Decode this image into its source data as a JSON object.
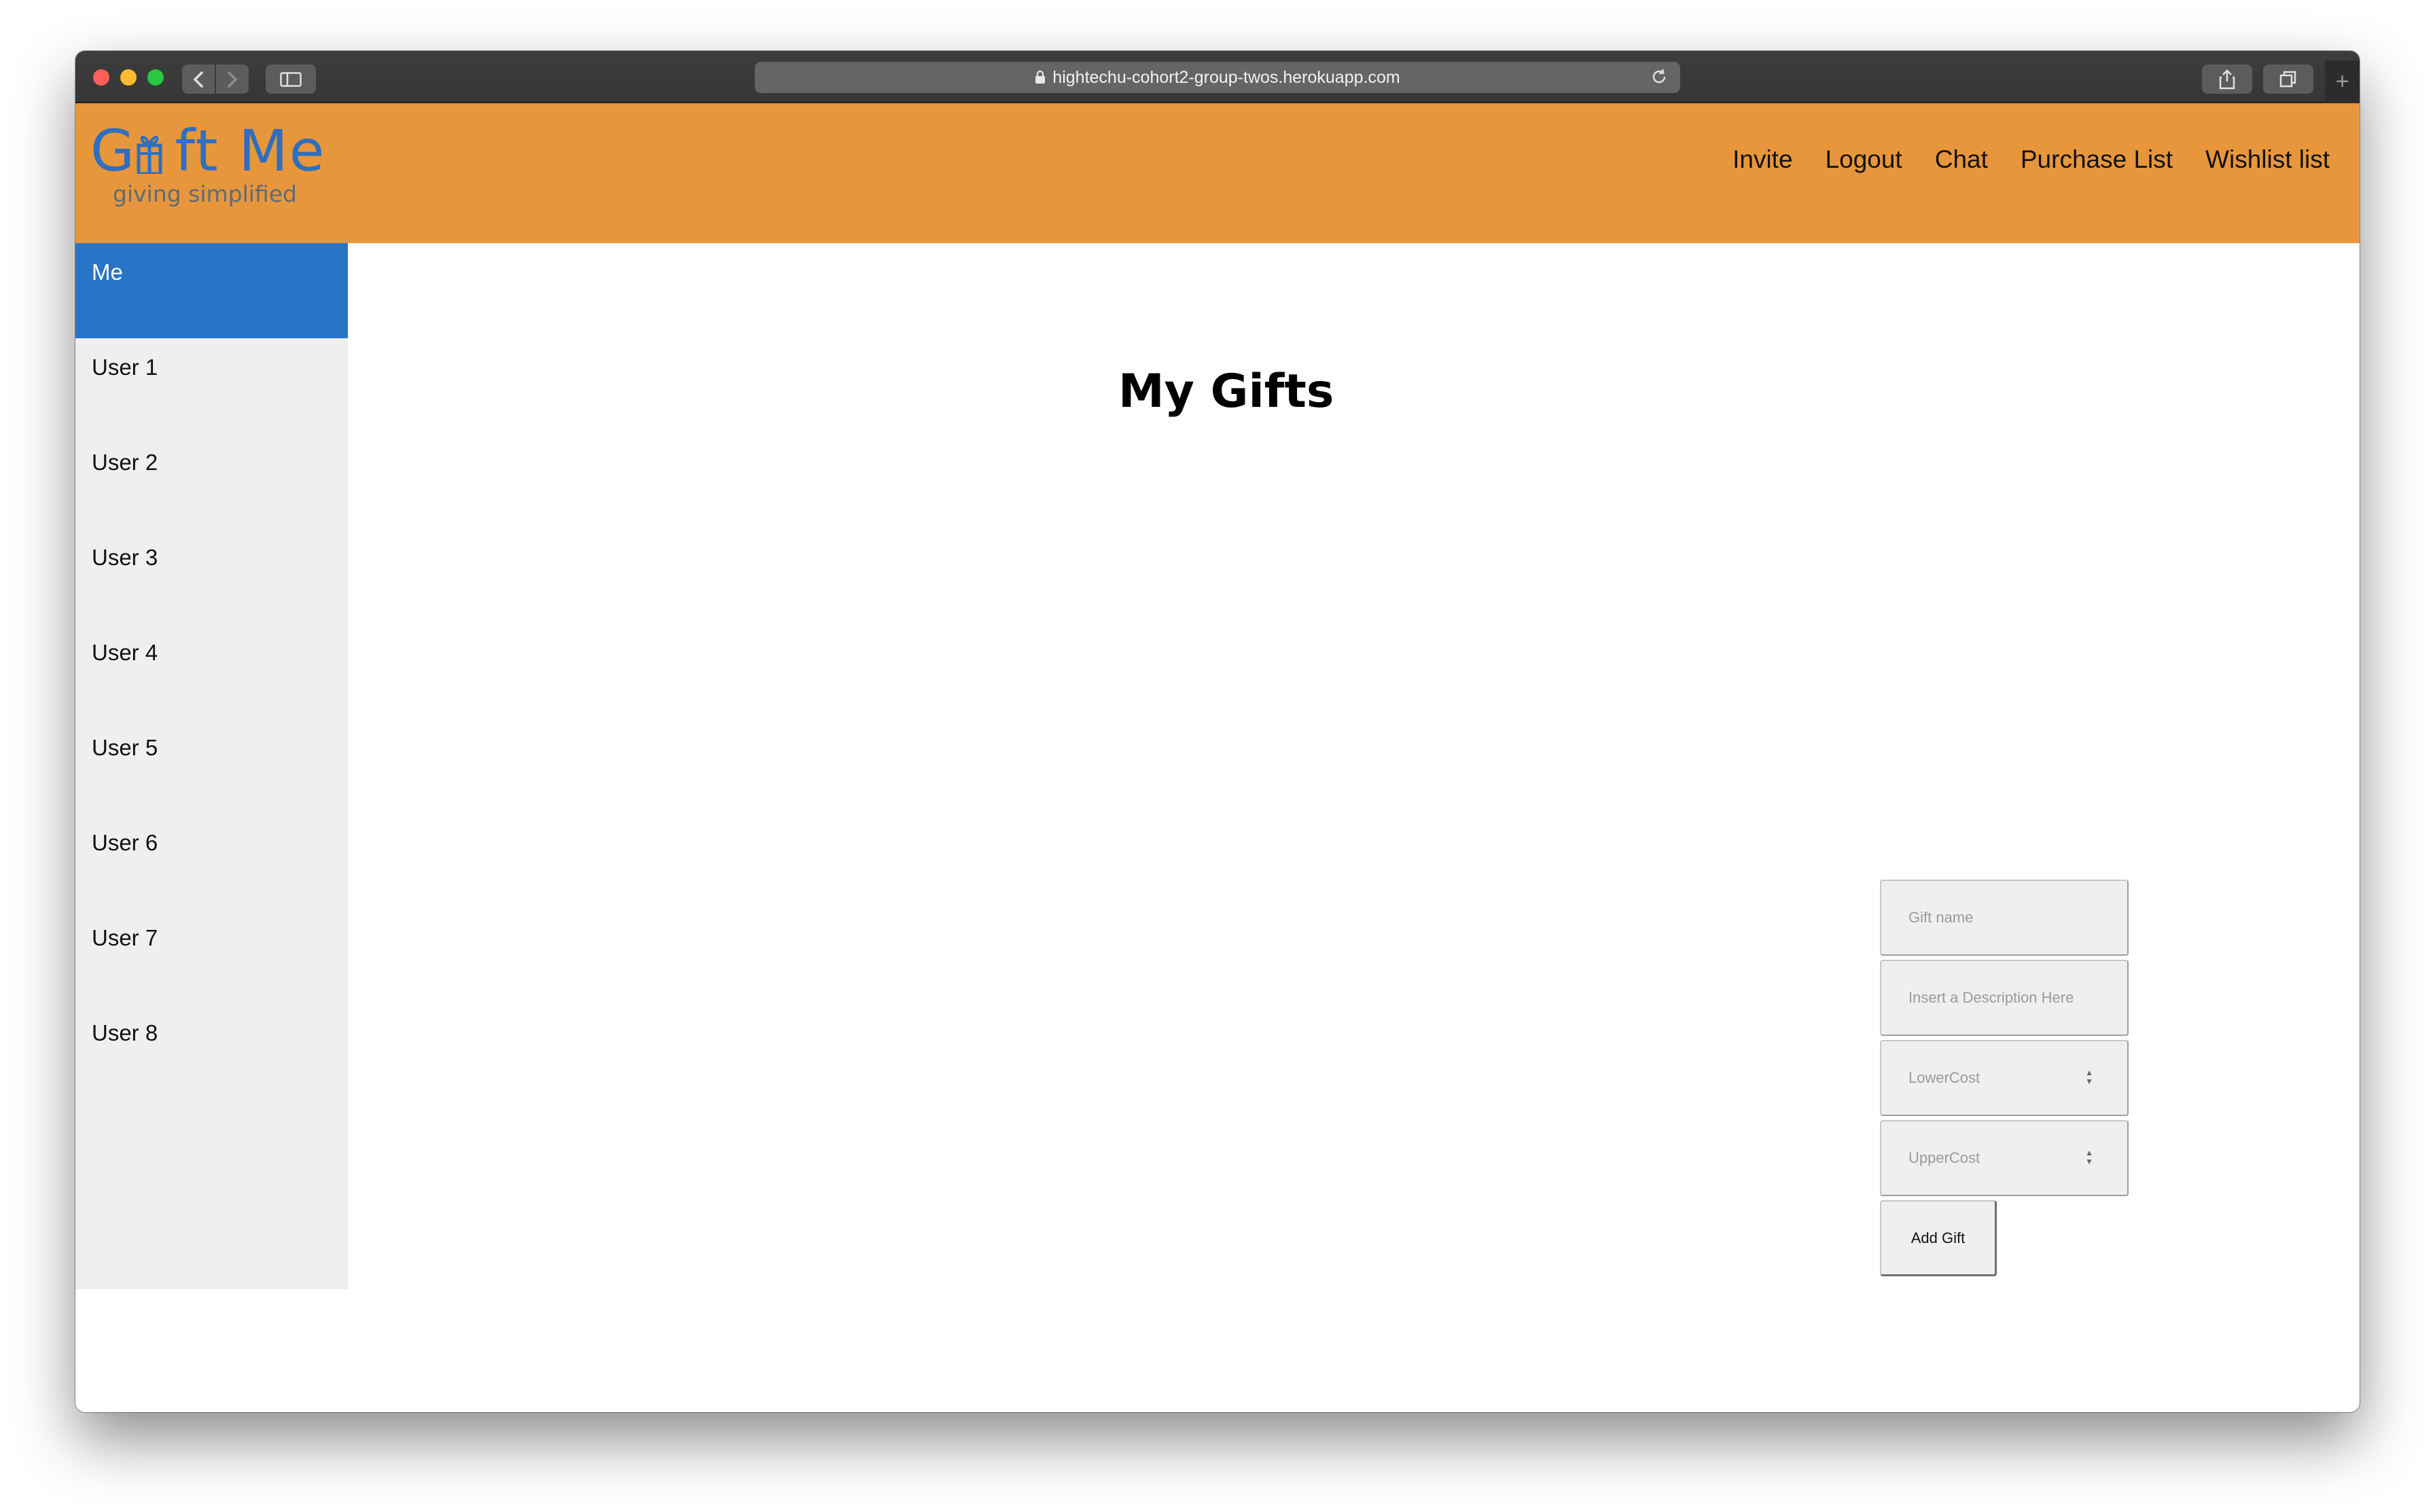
{
  "browser": {
    "url": "hightechu-cohort2-group-twos.herokuapp.com"
  },
  "header": {
    "logo_title": "G  ft Me",
    "logo_tagline": "giving simplified",
    "nav": [
      {
        "label": "Invite"
      },
      {
        "label": "Logout"
      },
      {
        "label": "Chat"
      },
      {
        "label": "Purchase List"
      },
      {
        "label": "Wishlist list"
      }
    ]
  },
  "sidebar": {
    "items": [
      {
        "label": "Me",
        "active": true
      },
      {
        "label": "User 1"
      },
      {
        "label": "User 2"
      },
      {
        "label": "User 3"
      },
      {
        "label": "User 4"
      },
      {
        "label": "User 5"
      },
      {
        "label": "User 6"
      },
      {
        "label": "User 7"
      },
      {
        "label": "User 8"
      }
    ]
  },
  "main": {
    "title": "My Gifts"
  },
  "form": {
    "gift_name_placeholder": "Gift name",
    "description_placeholder": "Insert a Description Here",
    "lower_cost_placeholder": "LowerCost",
    "upper_cost_placeholder": "UpperCost",
    "submit_label": "Add Gift"
  },
  "colors": {
    "header_bg": "#e8963c",
    "logo_blue": "#2e6fbf",
    "active_item": "#2874c6",
    "sidebar_bg": "#efefef"
  }
}
